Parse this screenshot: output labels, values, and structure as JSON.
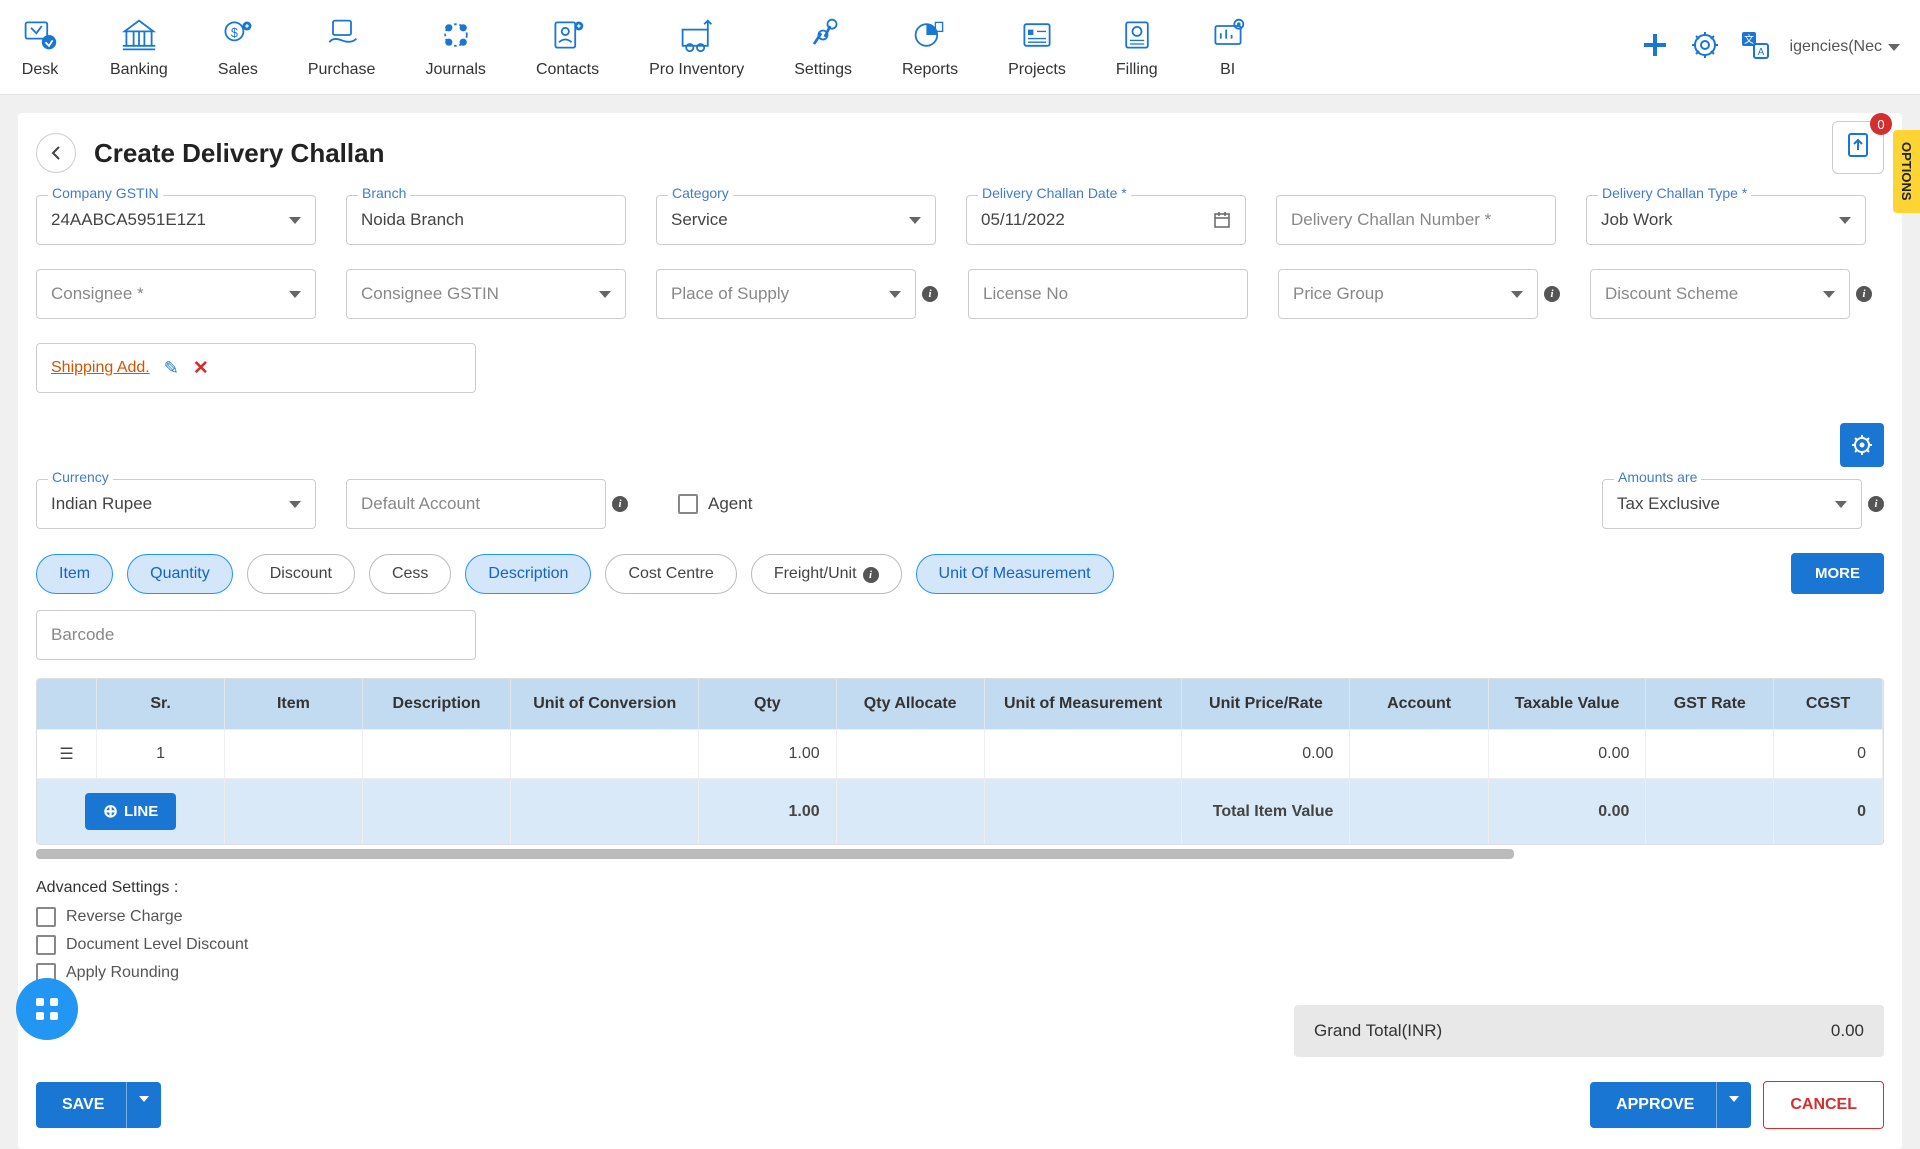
{
  "nav": [
    "Desk",
    "Banking",
    "Sales",
    "Purchase",
    "Journals",
    "Contacts",
    "Pro Inventory",
    "Settings",
    "Reports",
    "Projects",
    "Filling",
    "BI"
  ],
  "company_short": "igencies(Nec",
  "page_title": "Create Delivery Challan",
  "badge": "0",
  "options_tab": "OPTIONS",
  "fields": {
    "gstin_label": "Company GSTIN",
    "gstin_value": "24AABCA5951E1Z1",
    "branch_label": "Branch",
    "branch_value": "Noida Branch",
    "category_label": "Category",
    "category_value": "Service",
    "date_label": "Delivery Challan Date *",
    "date_value": "05/11/2022",
    "number_label": "Delivery Challan Number *",
    "type_label": "Delivery Challan Type *",
    "type_value": "Job Work",
    "consignee_label": "Consignee *",
    "consignee_gstin_label": "Consignee GSTIN",
    "supply_label": "Place of Supply",
    "license_label": "License No",
    "pricegroup_label": "Price Group",
    "discount_label": "Discount Scheme",
    "shipping_link": "Shipping Add.",
    "currency_label": "Currency",
    "currency_value": "Indian Rupee",
    "account_label": "Default Account",
    "agent_label": "Agent",
    "amounts_label": "Amounts are",
    "amounts_value": "Tax Exclusive"
  },
  "chips": [
    {
      "label": "Item",
      "active": true
    },
    {
      "label": "Quantity",
      "active": true
    },
    {
      "label": "Discount",
      "active": false
    },
    {
      "label": "Cess",
      "active": false
    },
    {
      "label": "Description",
      "active": true
    },
    {
      "label": "Cost Centre",
      "active": false
    },
    {
      "label": "Freight/Unit",
      "active": false,
      "info": true
    },
    {
      "label": "Unit Of Measurement",
      "active": true
    }
  ],
  "more_btn": "MORE",
  "barcode_placeholder": "Barcode",
  "table": {
    "headers": [
      "Sr.",
      "Item",
      "Description",
      "Unit of Conversion",
      "Qty",
      "Qty Allocate",
      "Unit of Measurement",
      "Unit Price/Rate",
      "Account",
      "Taxable Value",
      "GST Rate",
      "CGST"
    ],
    "row": {
      "sr": "1",
      "qty": "1.00",
      "rate": "0.00",
      "taxable": "0.00",
      "cgst": "0"
    },
    "line_btn": "LINE",
    "total_qty": "1.00",
    "total_label": "Total Item Value",
    "total_value": "0.00",
    "total_cgst": "0"
  },
  "advanced": {
    "title": "Advanced Settings :",
    "items": [
      "Reverse Charge",
      "Document Level Discount",
      "Apply Rounding"
    ]
  },
  "grand_total_label": "Grand Total(INR)",
  "grand_total_value": "0.00",
  "buttons": {
    "save": "SAVE",
    "approve": "APPROVE",
    "cancel": "CANCEL"
  }
}
